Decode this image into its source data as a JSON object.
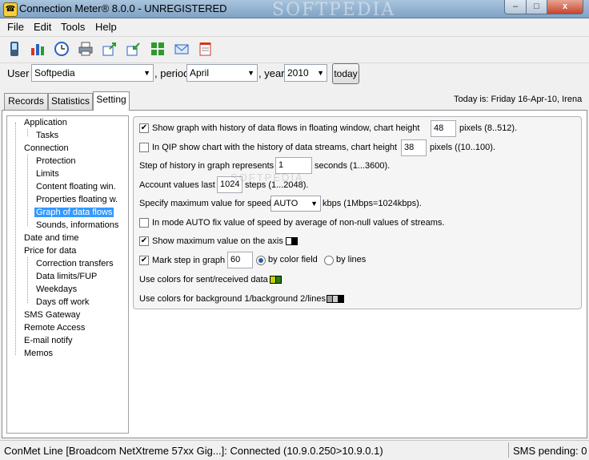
{
  "window": {
    "title": "Connection Meter® 8.0.0 - UNREGISTERED",
    "watermark": "SOFTPEDIA",
    "min_label": "–",
    "max_label": "□",
    "close_label": "x"
  },
  "menu": {
    "items": [
      "File",
      "Edit",
      "Tools",
      "Help"
    ]
  },
  "toolbar": {
    "icons": [
      "phone-icon",
      "chart-icon",
      "clock-icon",
      "printer-icon",
      "export-icon",
      "import-icon",
      "grid-icon",
      "email-icon",
      "notepad-icon"
    ]
  },
  "userbar": {
    "user_label": "User",
    "user_value": "Softpedia",
    "period_label": ", period",
    "period_value": "April",
    "year_label": ", year",
    "year_value": "2010",
    "today_button": "today"
  },
  "tabs": [
    "Records",
    "Statistics",
    "Setting"
  ],
  "active_tab": "Setting",
  "today_text": "Today is: Friday 16-Apr-10, Irena",
  "tree": {
    "items": [
      "Application",
      "Tasks",
      "Connection",
      "Protection",
      "Limits",
      "Content floating win.",
      "Properties floating w.",
      "Graph of data flows",
      "Sounds, informations",
      "Date and time",
      "Price for data",
      "Correction transfers",
      "Data limits/FUP",
      "Weekdays",
      "Days off work",
      "SMS Gateway",
      "Remote Access",
      "E-mail notify",
      "Memos"
    ],
    "selected": "Graph of data flows"
  },
  "settings": {
    "show_graph": {
      "checked": true,
      "label": "Show graph with history of data flows in floating window, chart height",
      "value": "48",
      "suffix": "pixels (8..512)."
    },
    "qip_chart": {
      "checked": false,
      "label": "In QIP show chart with the history of data streams, chart height",
      "value": "38",
      "suffix": "pixels ((10..100)."
    },
    "step_history": {
      "label": "Step of history in graph represents",
      "value": "1",
      "suffix": "seconds (1...3600)."
    },
    "account_values": {
      "label": "Account values last",
      "value": "1024",
      "suffix": "steps (1...2048)."
    },
    "max_speed": {
      "label": "Specify maximum value for speed",
      "value": "AUTO",
      "suffix": "kbps (1Mbps=1024kbps)."
    },
    "auto_fix": {
      "checked": false,
      "label": "In mode AUTO fix value of speed by average of non-null values of streams."
    },
    "show_max": {
      "checked": true,
      "label": "Show maximum value on the axis"
    },
    "mark_step": {
      "checked": true,
      "label": "Mark step in graph",
      "value": "60",
      "radio1": "by color field",
      "radio2": "by lines",
      "selected": "by color field"
    },
    "colors_sent": {
      "label": "Use colors for sent/received data",
      "colors": [
        "#c8d400",
        "#2e7d12"
      ]
    },
    "colors_bg": {
      "label": "Use colors for background 1/background 2/lines",
      "colors": [
        "#a0a0a0",
        "#d0d0d0",
        "#000000"
      ]
    },
    "show_max_colors": [
      "#ffffff",
      "#000000"
    ]
  },
  "statusbar": {
    "left": "ConMet Line [Broadcom NetXtreme 57xx Gig...]: Connected (10.9.0.250>10.9.0.1)",
    "right": "SMS pending: 0"
  }
}
